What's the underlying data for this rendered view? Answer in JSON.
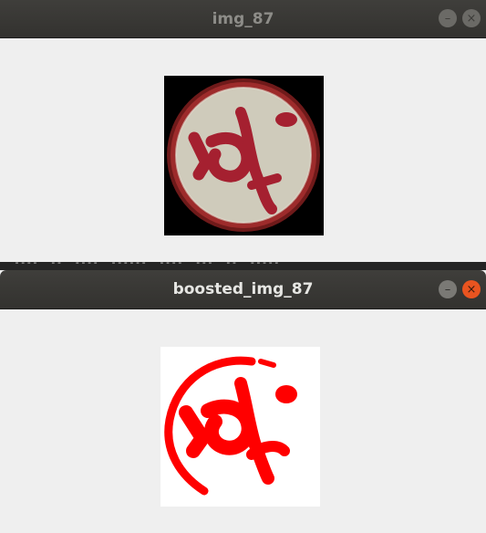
{
  "windows": [
    {
      "title": "img_87",
      "controls": {
        "minimize": "–",
        "close": "×"
      }
    },
    {
      "title": "boosted_img_87",
      "controls": {
        "minimize": "–",
        "close": "×"
      }
    }
  ],
  "terminal_fragment": "  ----  --  ----  ------  ----  ---  --  -----",
  "colors": {
    "titlebar": "#3a3936",
    "window_bg": "#efefef",
    "close_active": "#e95420",
    "seal_red": "#c1272d",
    "boosted_red": "#ff0000"
  },
  "icons": [
    "minimize-icon",
    "close-icon"
  ]
}
